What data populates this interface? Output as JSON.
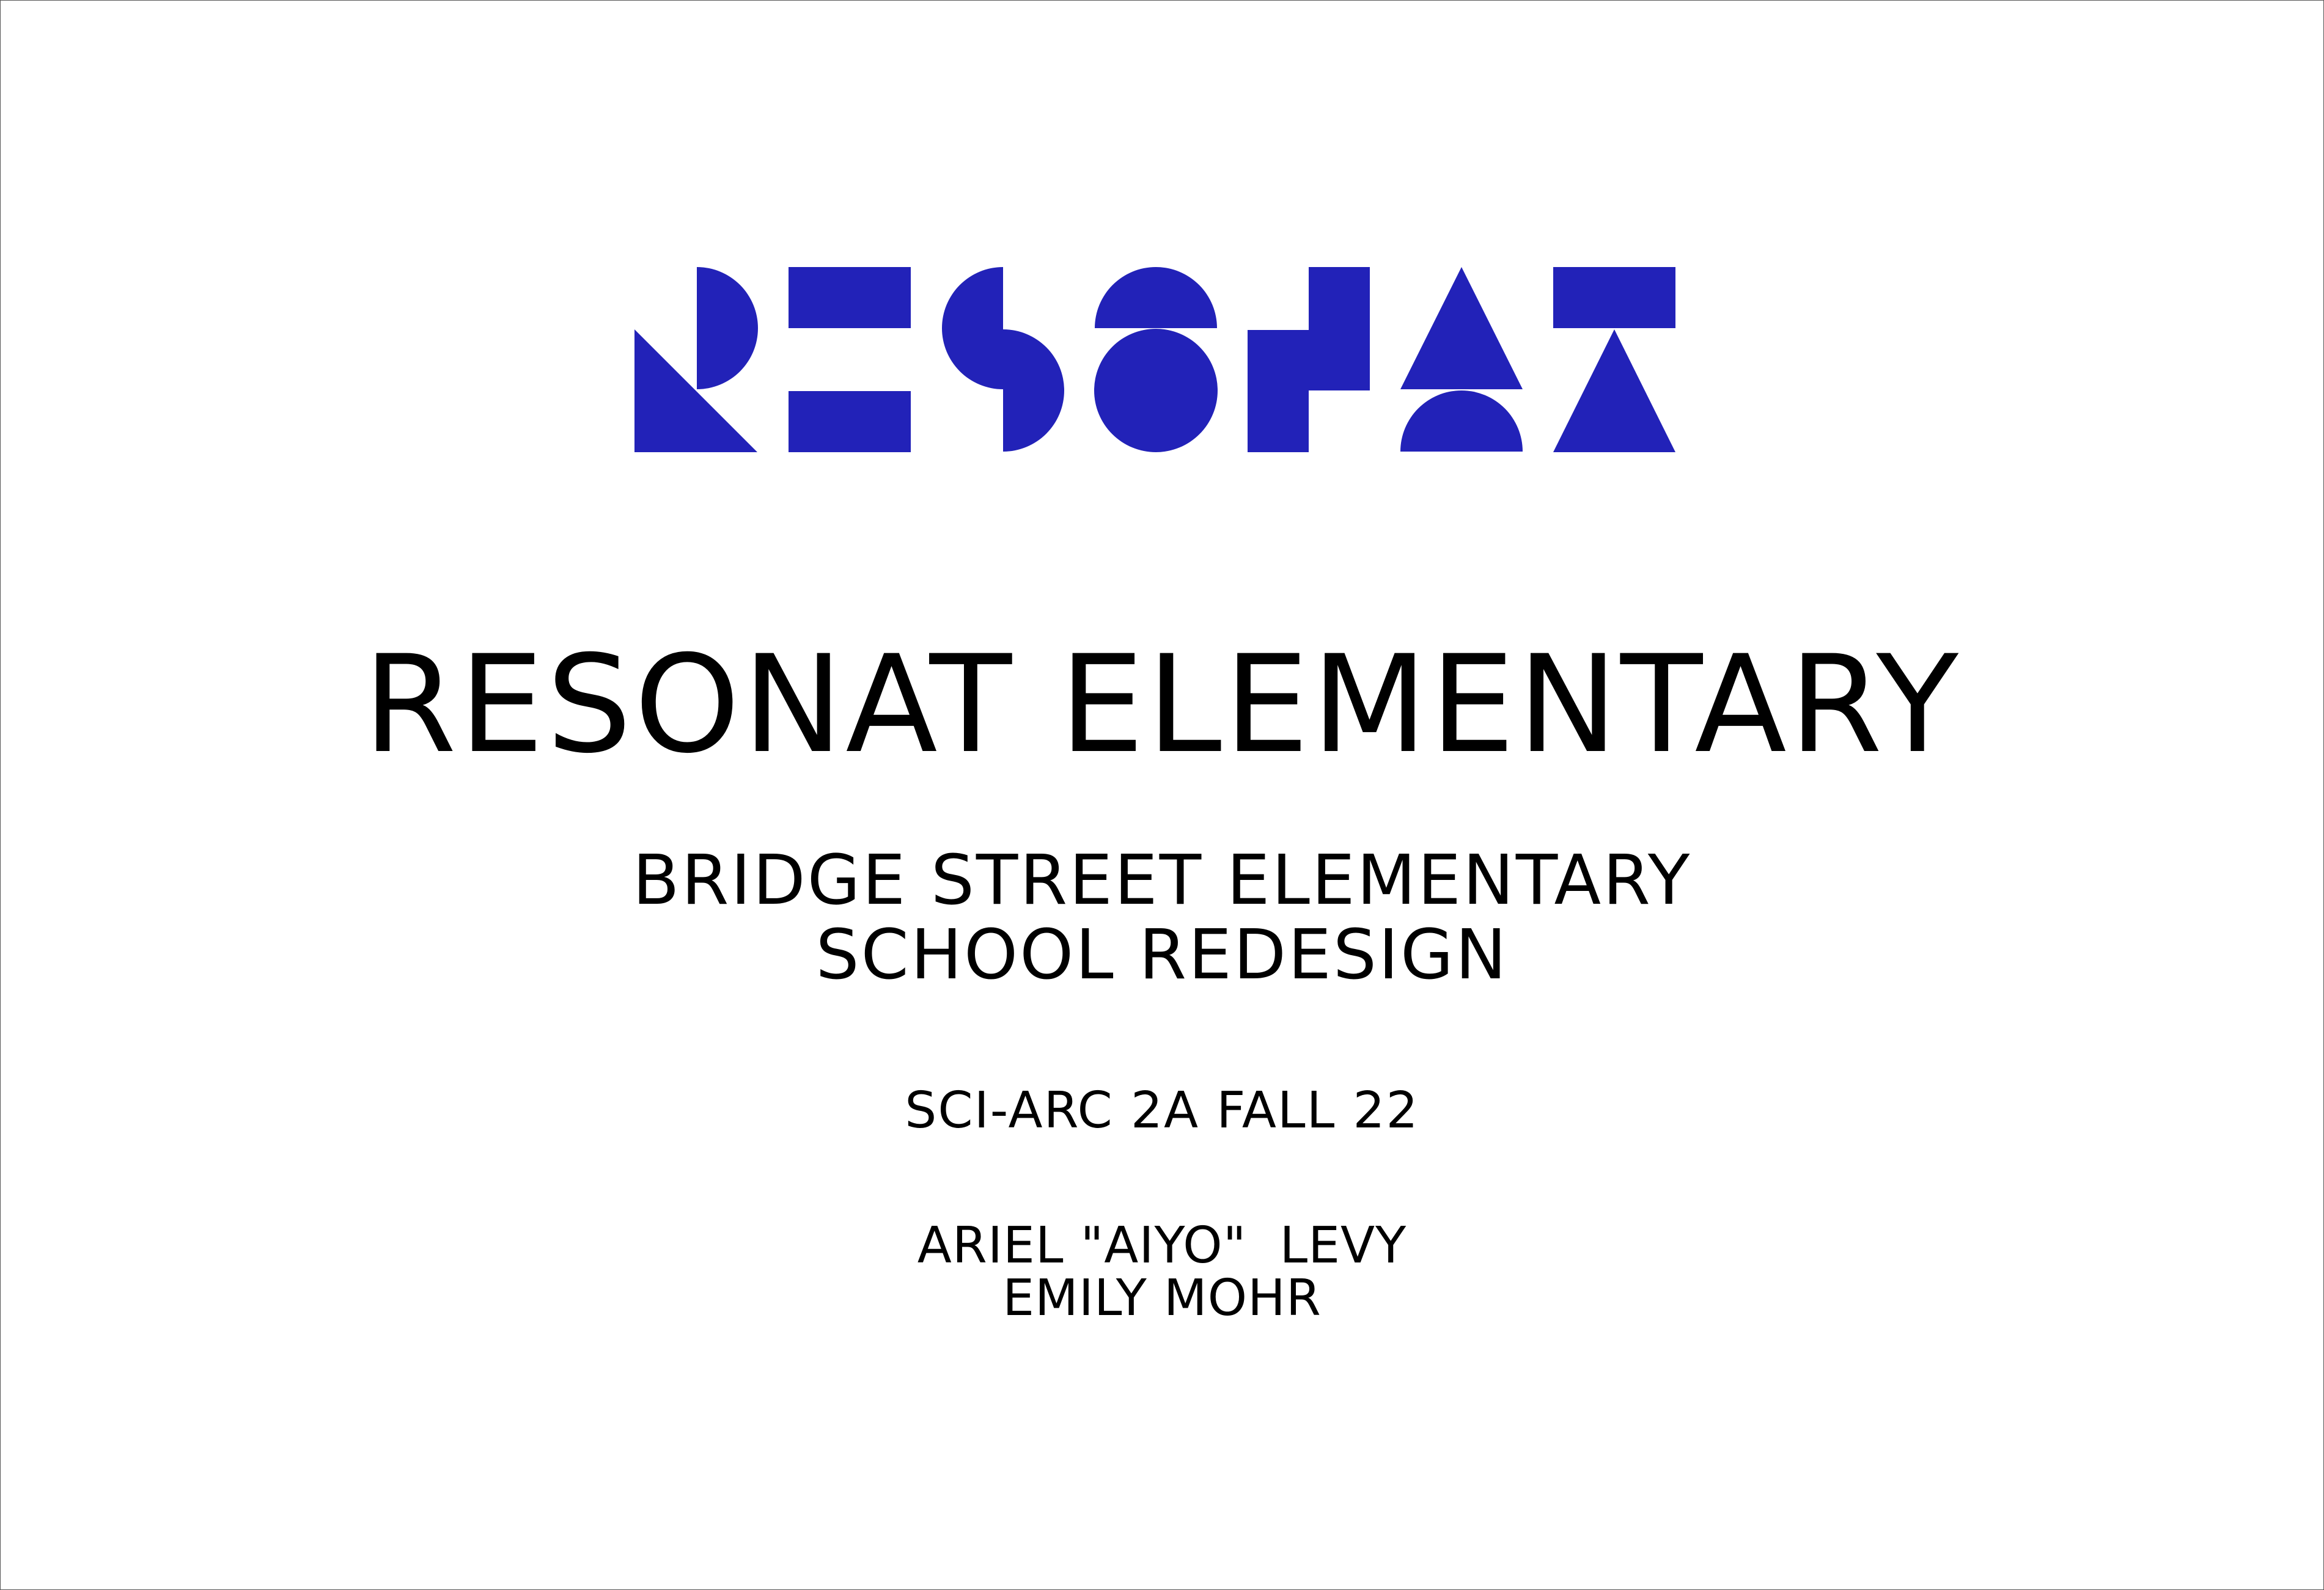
{
  "brand": {
    "logo_name": "RESONAT",
    "accent_color": "#2222b8"
  },
  "title": "RESONAT ELEMENTARY",
  "subtitle": {
    "line1": "BRIDGE STREET ELEMENTARY",
    "line2": "SCHOOL REDESIGN"
  },
  "course": "SCI-ARC 2A FALL 22",
  "authors": [
    "ARIEL \"AIYO\"  LEVY",
    "EMILY MOHR"
  ]
}
